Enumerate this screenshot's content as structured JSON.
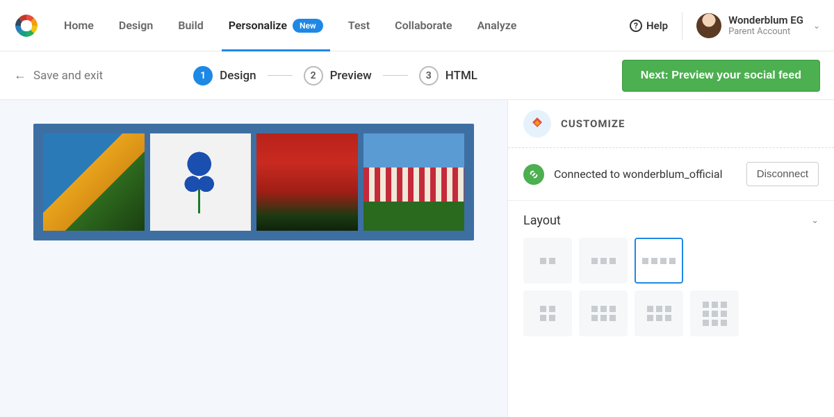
{
  "nav": {
    "items": [
      "Home",
      "Design",
      "Build",
      "Personalize",
      "Test",
      "Collaborate",
      "Analyze"
    ],
    "active_index": 3,
    "badge": "New",
    "help": "Help"
  },
  "account": {
    "name": "Wonderblum EG",
    "sub": "Parent Account"
  },
  "stepbar": {
    "save_exit": "Save and exit",
    "steps": [
      {
        "num": "1",
        "label": "Design"
      },
      {
        "num": "2",
        "label": "Preview"
      },
      {
        "num": "3",
        "label": "HTML"
      }
    ],
    "active_step": 0,
    "next_label": "Next: Preview your social feed"
  },
  "sidebar": {
    "customize_title": "CUSTOMIZE",
    "connected_text": "Connected to wonderblum_official",
    "disconnect_label": "Disconnect",
    "layout_title": "Layout",
    "layout_options": [
      {
        "cols": 2,
        "rows": 1
      },
      {
        "cols": 3,
        "rows": 1
      },
      {
        "cols": 4,
        "rows": 1
      },
      {
        "cols": 2,
        "rows": 2
      },
      {
        "cols": 3,
        "rows": 2
      },
      {
        "cols": 3,
        "rows": 2
      },
      {
        "cols": 3,
        "rows": 3
      }
    ],
    "layout_selected_index": 2
  }
}
